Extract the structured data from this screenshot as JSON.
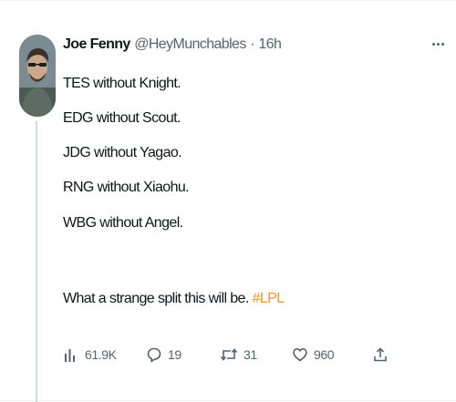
{
  "tweet": {
    "author_name": "Joe Fenny",
    "author_handle": "@HeyMunchables",
    "separator": "·",
    "time": "16h",
    "lines": [
      "TES without Knight.",
      "EDG without Scout.",
      "JDG without Yagao.",
      "RNG without Xiaohu.",
      "WBG without Angel."
    ],
    "closing_text": "What a strange split this will be. ",
    "hashtag": "#LPL"
  },
  "actions": {
    "views": "61.9K",
    "replies": "19",
    "retweets": "31",
    "likes": "960"
  },
  "icons": {
    "views": "bar-chart-icon",
    "reply": "speech-bubble-icon",
    "retweet": "retweet-arrows-icon",
    "like": "heart-icon",
    "share": "share-upload-icon",
    "more": "more-horizontal-icon"
  },
  "colors": {
    "text": "#0f1419",
    "secondary": "#536471",
    "hashtag": "#f7931e",
    "thread_line": "#cfd9de"
  }
}
